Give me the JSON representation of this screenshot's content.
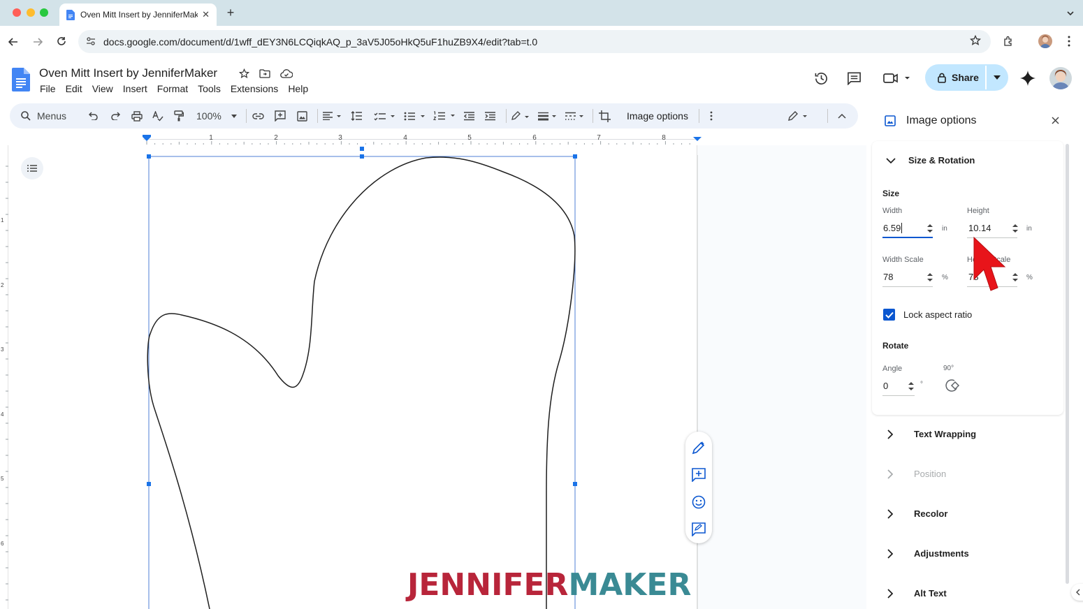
{
  "browser": {
    "tab_title": "Oven Mitt Insert by JenniferMaker",
    "url": "docs.google.com/document/d/1wff_dEY3N6LCQiqkAQ_p_3aV5J05oHkQ5uF1huZB9X4/edit?tab=t.0"
  },
  "doc": {
    "title": "Oven Mitt Insert by JenniferMaker",
    "menus": [
      "File",
      "Edit",
      "View",
      "Insert",
      "Format",
      "Tools",
      "Extensions",
      "Help"
    ],
    "share_label": "Share"
  },
  "toolbar": {
    "search_label": "Menus",
    "zoom": "100%",
    "image_options_label": "Image options"
  },
  "ruler": {
    "ticks": [
      "1",
      "2",
      "3",
      "4",
      "5",
      "6",
      "7",
      "8"
    ]
  },
  "panel": {
    "title": "Image options",
    "size_rotation": {
      "title": "Size & Rotation",
      "size_heading": "Size",
      "width_label": "Width",
      "width_value": "6.59",
      "width_unit": "in",
      "height_label": "Height",
      "height_value": "10.14",
      "height_unit": "in",
      "width_scale_label": "Width Scale",
      "width_scale_value": "78",
      "width_scale_unit": "%",
      "height_scale_label": "Height Scale",
      "height_scale_value": "78",
      "height_scale_unit": "%",
      "lock_label": "Lock aspect ratio",
      "lock_checked": true,
      "rotate_heading": "Rotate",
      "angle_label": "Angle",
      "angle_value": "0",
      "angle_unit": "°",
      "rotate90_label": "90°"
    },
    "sections": [
      "Text Wrapping",
      "Position",
      "Recolor",
      "Adjustments",
      "Alt Text"
    ]
  },
  "watermark": {
    "part1": "JENNIFER",
    "part2": "MAKER"
  },
  "colors": {
    "accent": "#0b57d0",
    "share_bg": "#c2e7ff",
    "watermark_red": "#b8253a",
    "watermark_teal": "#3a8a94",
    "cursor": "#e8141a"
  }
}
